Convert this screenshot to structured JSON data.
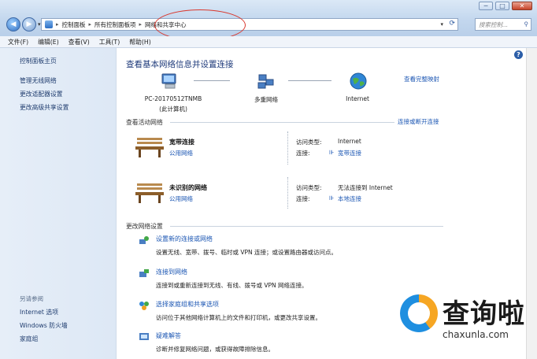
{
  "window": {
    "controls": [
      "─",
      "□",
      "✕"
    ]
  },
  "address": {
    "crumbs": [
      "控制面板",
      "所有控制面板项",
      "网络和共享中心"
    ],
    "search_placeholder": "搜索控制..."
  },
  "menu": [
    "文件(F)",
    "编辑(E)",
    "查看(V)",
    "工具(T)",
    "帮助(H)"
  ],
  "sidebar": {
    "items": [
      "控制面板主页",
      "管理无线网络",
      "更改适配器设置",
      "更改高级共享设置"
    ],
    "see_also_title": "另请参阅",
    "see_also": [
      "Internet 选项",
      "Windows 防火墙",
      "家庭组"
    ]
  },
  "main": {
    "heading": "查看基本网络信息并设置连接",
    "full_map_link": "查看完整映射",
    "nodes": [
      {
        "label": "PC-20170512TNMB",
        "sublabel": "(此计算机)",
        "icon": "computer-icon"
      },
      {
        "label": "多重网络",
        "icon": "multiple-networks-icon"
      },
      {
        "label": "Internet",
        "icon": "globe-icon"
      }
    ],
    "active_title": "查看活动网络",
    "connect_link": "连接或断开连接",
    "networks": [
      {
        "name": "宽带连接",
        "type": "公用网络",
        "access_label": "访问类型:",
        "access_value": "Internet",
        "conn_label": "连接:",
        "conn_value": "宽带连接"
      },
      {
        "name": "未识别的网络",
        "type": "公用网络",
        "access_label": "访问类型:",
        "access_value": "无法连接到 Internet",
        "conn_label": "连接:",
        "conn_value": "本地连接"
      }
    ],
    "change_title": "更改网络设置",
    "tasks": [
      {
        "title": "设置新的连接或网络",
        "desc": "设置无线、宽带、拨号、临时或 VPN 连接；或设置路由器或访问点。"
      },
      {
        "title": "连接到网络",
        "desc": "连接到或重新连接到无线、有线、拨号或 VPN 网络连接。"
      },
      {
        "title": "选择家庭组和共享选项",
        "desc": "访问位于其他网络计算机上的文件和打印机，或更改共享设置。"
      },
      {
        "title": "疑难解答",
        "desc": "诊断并修复网络问题，或获得故障排除信息。"
      }
    ]
  },
  "watermark": {
    "brand": "查询啦",
    "url": "chaxunla.com"
  }
}
